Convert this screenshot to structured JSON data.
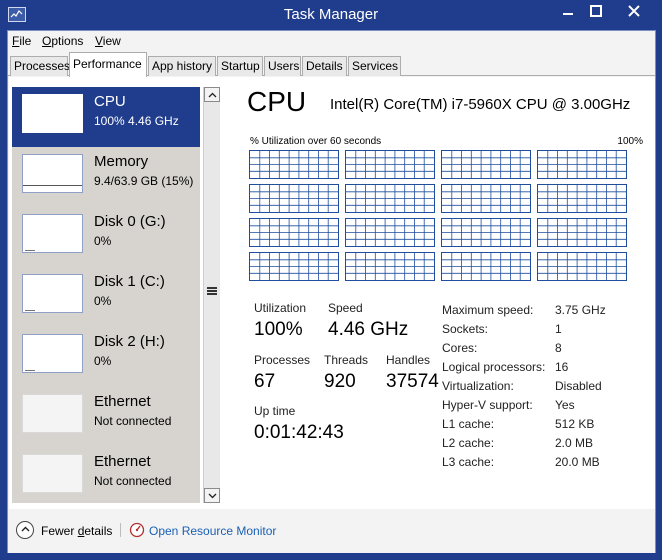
{
  "window": {
    "title": "Task Manager",
    "accent_color": "#1f3d8c",
    "graph_line_color": "#1f4e9e",
    "link_color": "#1a5fb4"
  },
  "menu": {
    "file": {
      "key": "F",
      "rest": "ile"
    },
    "options": {
      "key": "O",
      "rest": "ptions"
    },
    "view": {
      "key": "V",
      "rest": "iew"
    }
  },
  "tabs": [
    "Processes",
    "Performance",
    "App history",
    "Startup",
    "Users",
    "Details",
    "Services"
  ],
  "active_tab": "Performance",
  "sidebar": {
    "items": [
      {
        "name": "CPU",
        "sub": "100%  4.46 GHz",
        "selected": true,
        "level": 1.0
      },
      {
        "name": "Memory",
        "sub": "9.4/63.9 GB (15%)",
        "selected": false,
        "level": 0.15
      },
      {
        "name": "Disk 0 (G:)",
        "sub": "0%",
        "selected": false,
        "level": 0
      },
      {
        "name": "Disk 1 (C:)",
        "sub": "0%",
        "selected": false,
        "level": 0
      },
      {
        "name": "Disk 2 (H:)",
        "sub": "0%",
        "selected": false,
        "level": 0
      },
      {
        "name": "Ethernet",
        "sub": "Not connected",
        "selected": false,
        "level": 0
      },
      {
        "name": "Ethernet",
        "sub": "Not connected",
        "selected": false,
        "level": 0
      }
    ]
  },
  "cpu": {
    "title": "CPU",
    "model": "Intel(R) Core(TM) i7-5960X CPU @ 3.00GHz",
    "graph_label": "% Utilization over 60 seconds",
    "graph_max": "100%",
    "logical_processor_graphs": 16,
    "stats": {
      "utilization_label": "Utilization",
      "utilization_value": "100%",
      "speed_label": "Speed",
      "speed_value": "4.46 GHz",
      "processes_label": "Processes",
      "processes_value": "67",
      "threads_label": "Threads",
      "threads_value": "920",
      "handles_label": "Handles",
      "handles_value": "37574",
      "uptime_label": "Up time",
      "uptime_value": "0:01:42:43"
    },
    "specs": [
      {
        "label": "Maximum speed:",
        "value": "3.75 GHz"
      },
      {
        "label": "Sockets:",
        "value": "1"
      },
      {
        "label": "Cores:",
        "value": "8"
      },
      {
        "label": "Logical processors:",
        "value": "16"
      },
      {
        "label": "Virtualization:",
        "value": "Disabled"
      },
      {
        "label": "Hyper-V support:",
        "value": "Yes"
      },
      {
        "label": "L1 cache:",
        "value": "512 KB"
      },
      {
        "label": "L2 cache:",
        "value": "2.0 MB"
      },
      {
        "label": "L3 cache:",
        "value": "20.0 MB"
      }
    ]
  },
  "footer": {
    "fewer_details_key": "d",
    "fewer_details_pre": "Fewer ",
    "fewer_details_post": "etails",
    "open_monitor": "Open Resource Monitor"
  }
}
